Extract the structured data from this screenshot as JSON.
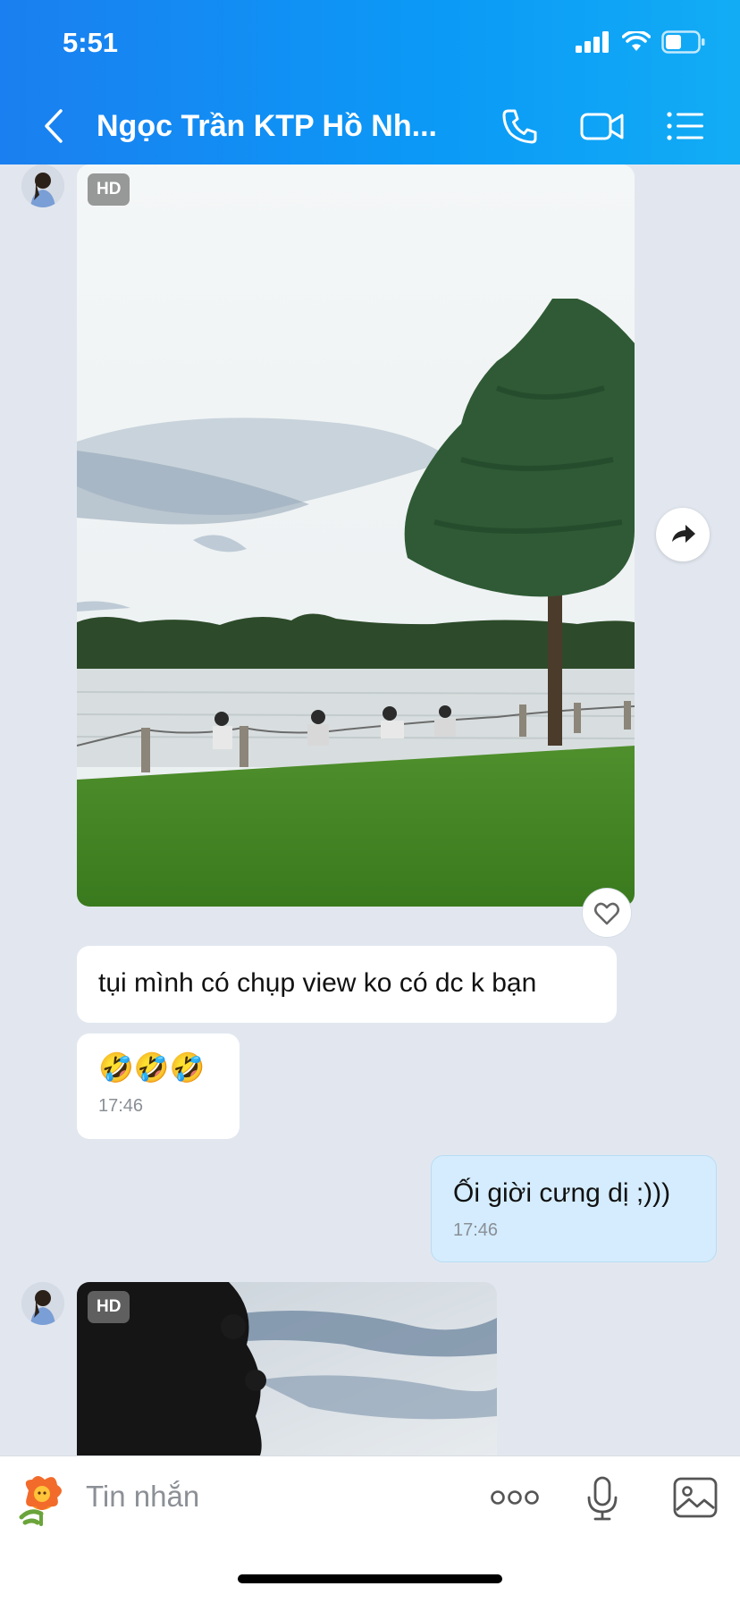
{
  "status_bar": {
    "time": "5:51"
  },
  "header": {
    "title": "Ngọc Trần KTP Hồ Nh...",
    "icons": [
      "back-icon",
      "phone-icon",
      "video-call-icon",
      "list-menu-icon"
    ]
  },
  "messages": {
    "photo1": {
      "badge": "HD"
    },
    "text1": "tụi mình có chụp view ko có dc k bạn",
    "emoji_msg": {
      "text": "🤣🤣🤣",
      "time": "17:46"
    },
    "my_msg": {
      "text": "Ối giời cưng dị ;)))",
      "time": "17:46"
    },
    "photo2": {
      "badge": "HD"
    }
  },
  "input_bar": {
    "placeholder": "Tin nhắn"
  },
  "colors": {
    "header_start": "#1a7ff0",
    "header_end": "#12acf5",
    "chat_bg": "#e2e7ef",
    "my_bubble": "#d4ecfd"
  }
}
